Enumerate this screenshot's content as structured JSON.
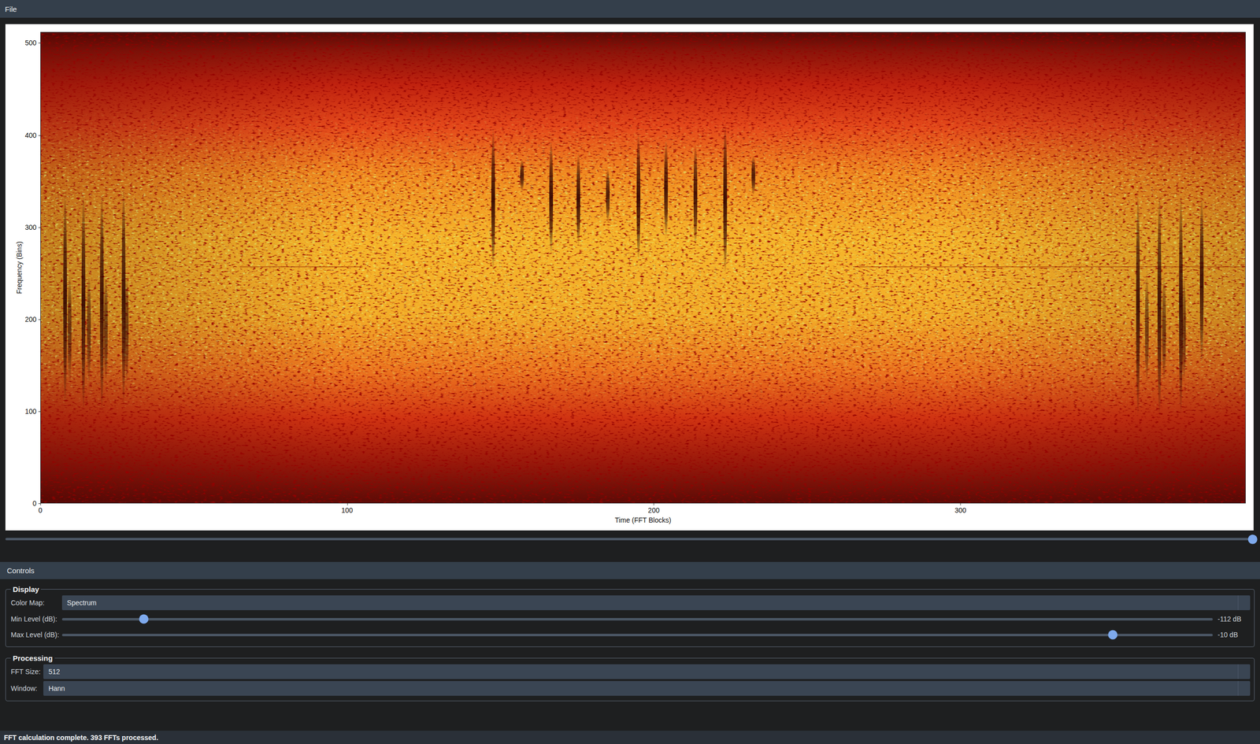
{
  "menu": [
    {
      "label": "File"
    }
  ],
  "plot": {
    "y_axis": {
      "title": "Frequency (Bins)",
      "ticks": [
        "0",
        "100",
        "200",
        "300",
        "400",
        "500"
      ],
      "max": 512
    },
    "x_axis": {
      "title": "Time (FFT Blocks)",
      "ticks": [
        "0",
        "100",
        "200",
        "300"
      ],
      "max": 393
    },
    "events": [
      {
        "t": 7.9,
        "f_min": 106,
        "f_max": 339,
        "level": 0.9
      },
      {
        "t": 9.4,
        "f_min": 130,
        "f_max": 250,
        "level": 0.6
      },
      {
        "t": 13.9,
        "f_min": 100,
        "f_max": 339,
        "level": 0.9
      },
      {
        "t": 15.7,
        "f_min": 130,
        "f_max": 250,
        "level": 0.6
      },
      {
        "t": 19.9,
        "f_min": 100,
        "f_max": 339,
        "level": 0.9
      },
      {
        "t": 21.2,
        "f_min": 130,
        "f_max": 250,
        "level": 0.6
      },
      {
        "t": 27.0,
        "f_min": 106,
        "f_max": 345,
        "level": 0.9
      },
      {
        "t": 28.0,
        "f_min": 130,
        "f_max": 250,
        "level": 0.6
      },
      {
        "t": 147.6,
        "f_min": 253,
        "f_max": 408,
        "level": 0.95
      },
      {
        "t": 157.0,
        "f_min": 339,
        "f_max": 374,
        "level": 0.85
      },
      {
        "t": 166.5,
        "f_min": 270,
        "f_max": 395,
        "level": 0.95
      },
      {
        "t": 175.4,
        "f_min": 279,
        "f_max": 382,
        "level": 0.95
      },
      {
        "t": 185.0,
        "f_min": 305,
        "f_max": 365,
        "level": 0.85
      },
      {
        "t": 195.0,
        "f_min": 262,
        "f_max": 404,
        "level": 0.95
      },
      {
        "t": 204.0,
        "f_min": 288,
        "f_max": 395,
        "level": 0.9
      },
      {
        "t": 213.6,
        "f_min": 279,
        "f_max": 391,
        "level": 0.9
      },
      {
        "t": 223.3,
        "f_min": 249,
        "f_max": 413,
        "level": 0.95
      },
      {
        "t": 232.5,
        "f_min": 335,
        "f_max": 378,
        "level": 0.85
      },
      {
        "t": 358.0,
        "f_min": 93,
        "f_max": 339,
        "level": 0.9
      },
      {
        "t": 360.9,
        "f_min": 130,
        "f_max": 250,
        "level": 0.6
      },
      {
        "t": 365.0,
        "f_min": 93,
        "f_max": 339,
        "level": 0.9
      },
      {
        "t": 366.5,
        "f_min": 130,
        "f_max": 250,
        "level": 0.6
      },
      {
        "t": 372.0,
        "f_min": 95,
        "f_max": 339,
        "level": 0.9
      },
      {
        "t": 373.0,
        "f_min": 130,
        "f_max": 250,
        "level": 0.6
      },
      {
        "t": 378.8,
        "f_min": 150,
        "f_max": 335,
        "level": 0.9
      }
    ],
    "lines": [
      {
        "f": 257,
        "t_start": 65,
        "t_end": 105
      },
      {
        "f": 257,
        "t_start": 265,
        "t_end": 393
      }
    ]
  },
  "time_slider": {
    "level": 1.0
  },
  "controls": {
    "title": "Controls",
    "groups": [
      {
        "title": "Display",
        "rows": [
          {
            "kind": "select",
            "label": "Color Map:",
            "value": "Spectrum"
          },
          {
            "kind": "slider",
            "label": "Min Level (dB):",
            "level": 0.071,
            "reading": "-112 dB"
          },
          {
            "kind": "slider",
            "label": "Max Level (dB):",
            "level": 0.913,
            "reading": "-10 dB"
          }
        ]
      },
      {
        "title": "Processing",
        "rows": [
          {
            "kind": "select",
            "label": "FFT Size:",
            "value": "512"
          },
          {
            "kind": "select",
            "label": "Window:",
            "value": "Hann"
          }
        ]
      }
    ]
  },
  "status_bar": "FFT calculation complete. 393 FFTs processed."
}
